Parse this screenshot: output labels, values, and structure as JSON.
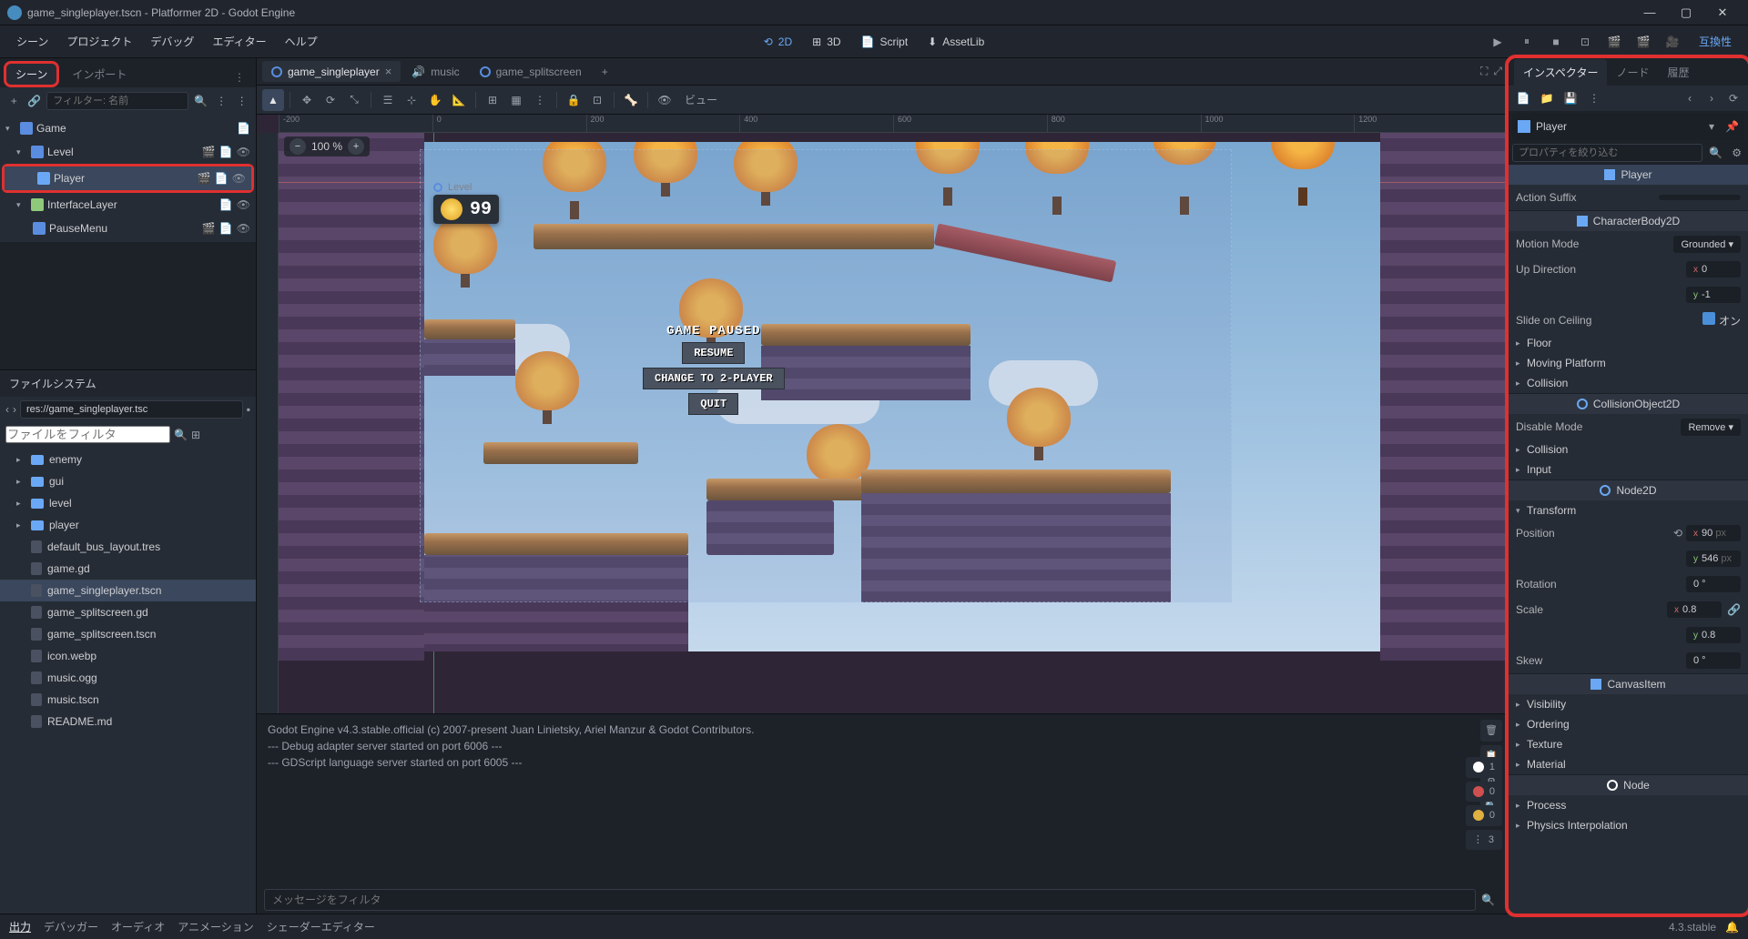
{
  "window": {
    "title": "game_singleplayer.tscn - Platformer 2D - Godot Engine"
  },
  "menubar": {
    "items": [
      "シーン",
      "プロジェクト",
      "デバッグ",
      "エディター",
      "ヘルプ"
    ],
    "switches": {
      "2d": "2D",
      "3d": "3D",
      "script": "Script",
      "assetlib": "AssetLib"
    },
    "compat": "互換性"
  },
  "scene_dock": {
    "tabs": {
      "scene": "シーン",
      "import": "インポート"
    },
    "filter_placeholder": "フィルター: 名前",
    "tree": [
      {
        "label": "Game",
        "depth": 0,
        "icon": "node2d",
        "arrow": "▾"
      },
      {
        "label": "Level",
        "depth": 1,
        "icon": "node2d",
        "arrow": "▾",
        "extras": true
      },
      {
        "label": "Player",
        "depth": 2,
        "icon": "player",
        "selected": true,
        "extras": true
      },
      {
        "label": "InterfaceLayer",
        "depth": 1,
        "icon": "layer",
        "arrow": "▾",
        "extras": true
      },
      {
        "label": "PauseMenu",
        "depth": 2,
        "icon": "node2d",
        "extras": true
      }
    ]
  },
  "filesystem": {
    "title": "ファイルシステム",
    "path": "res://game_singleplayer.tsc",
    "filter_placeholder": "ファイルをフィルタ",
    "items": [
      {
        "label": "enemy",
        "type": "folder"
      },
      {
        "label": "gui",
        "type": "folder"
      },
      {
        "label": "level",
        "type": "folder"
      },
      {
        "label": "player",
        "type": "folder"
      },
      {
        "label": "default_bus_layout.tres",
        "type": "file"
      },
      {
        "label": "game.gd",
        "type": "file"
      },
      {
        "label": "game_singleplayer.tscn",
        "type": "file",
        "selected": true
      },
      {
        "label": "game_splitscreen.gd",
        "type": "file"
      },
      {
        "label": "game_splitscreen.tscn",
        "type": "file"
      },
      {
        "label": "icon.webp",
        "type": "file"
      },
      {
        "label": "music.ogg",
        "type": "file"
      },
      {
        "label": "music.tscn",
        "type": "file"
      },
      {
        "label": "README.md",
        "type": "file"
      }
    ]
  },
  "scene_tabs": [
    {
      "label": "game_singleplayer",
      "active": true,
      "closable": true
    },
    {
      "label": "music",
      "active": false,
      "icon": "audio"
    },
    {
      "label": "game_splitscreen",
      "active": false
    }
  ],
  "viewport": {
    "zoom": "100 %",
    "view_label": "ビュー",
    "level_label": "Level",
    "coin_count": "99",
    "ruler_marks": [
      "-200",
      "0",
      "200",
      "400",
      "600",
      "800",
      "1000",
      "1200"
    ],
    "pause": {
      "title": "GAME PAUSED",
      "resume": "RESUME",
      "change": "CHANGE TO 2-PLAYER",
      "quit": "QUIT"
    }
  },
  "output": {
    "lines": [
      "Godot Engine v4.3.stable.official (c) 2007-present Juan Linietsky, Ariel Manzur & Godot Contributors.",
      "--- Debug adapter server started on port 6006 ---",
      "--- GDScript language server started on port 6005 ---"
    ],
    "counters": {
      "error": "1",
      "warning": "0",
      "info": "0",
      "msg": "3"
    },
    "filter_placeholder": "メッセージをフィルタ"
  },
  "bottom_tabs": [
    "出力",
    "デバッガー",
    "オーディオ",
    "アニメーション",
    "シェーダーエディター"
  ],
  "version": "4.3.stable",
  "inspector": {
    "tabs": {
      "inspector": "インスペクター",
      "node": "ノード",
      "history": "履歴"
    },
    "node_name": "Player",
    "filter_placeholder": "プロパティを絞り込む",
    "sections": {
      "player_class": "Player",
      "action_suffix": "Action Suffix",
      "characterbody2d": "CharacterBody2D",
      "motion_mode_label": "Motion Mode",
      "motion_mode_value": "Grounded",
      "up_direction_label": "Up Direction",
      "up_x": "0",
      "up_y": "-1",
      "slide_label": "Slide on Ceiling",
      "slide_value": "オン",
      "floor": "Floor",
      "moving_platform": "Moving Platform",
      "collision": "Collision",
      "collisionobject2d": "CollisionObject2D",
      "disable_mode_label": "Disable Mode",
      "disable_mode_value": "Remove",
      "collision2": "Collision",
      "input": "Input",
      "node2d": "Node2D",
      "transform": "Transform",
      "position_label": "Position",
      "pos_x": "90",
      "pos_y": "546",
      "pos_unit": "px",
      "rotation_label": "Rotation",
      "rotation_value": "0",
      "scale_label": "Scale",
      "scale_x": "0.8",
      "scale_y": "0.8",
      "skew_label": "Skew",
      "skew_value": "0",
      "canvasitem": "CanvasItem",
      "visibility": "Visibility",
      "ordering": "Ordering",
      "texture": "Texture",
      "material": "Material",
      "node_class": "Node",
      "process": "Process",
      "physics_interp": "Physics Interpolation"
    }
  }
}
